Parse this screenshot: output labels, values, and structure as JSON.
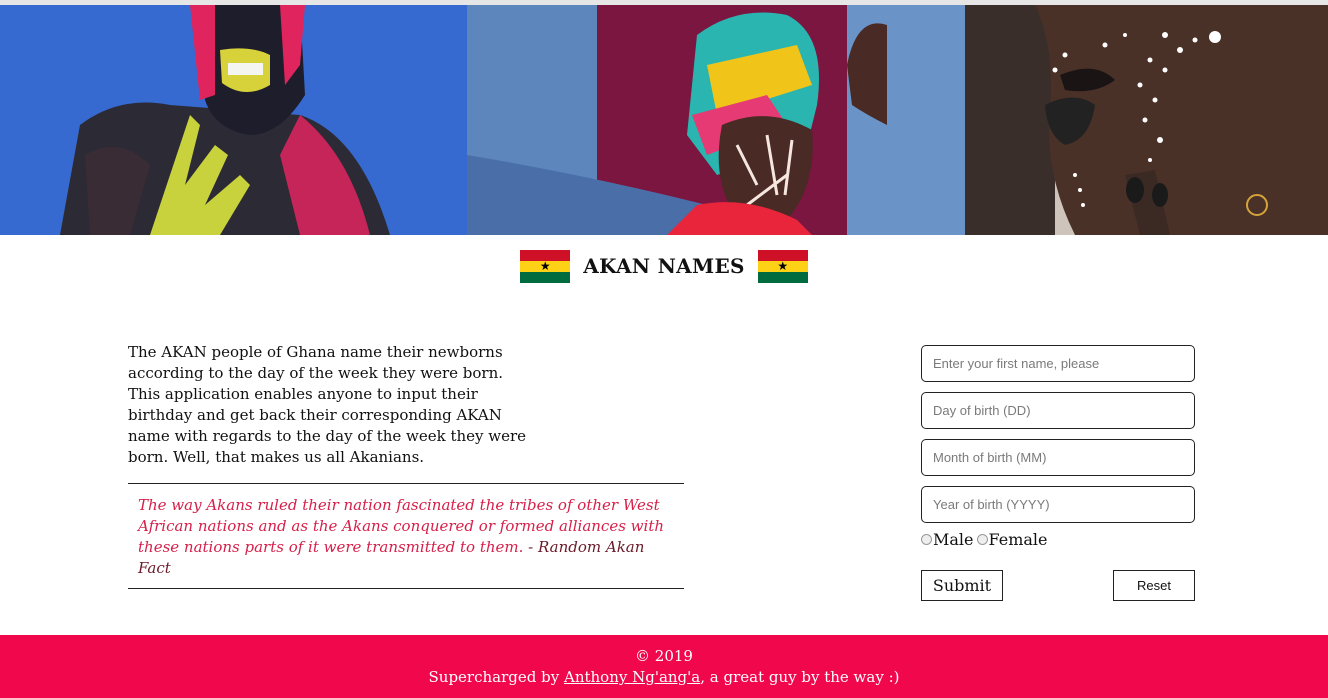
{
  "header": {
    "title": "AKAN NAMES",
    "flag_colors": [
      "#ce1126",
      "#fcd116",
      "#006b3f"
    ]
  },
  "intro": {
    "text": "The AKAN people of Ghana name their newborns according to the day of the week they were born. This application enables anyone to input their birthday and get back their corresponding AKAN name with regards to the day of the week they were born. Well, that makes us all Akanians."
  },
  "quote": {
    "text": "The way Akans ruled their nation fascinated the tribes of other West African nations and as the Akans conquered or formed alliances with these nations parts of it were transmitted to them.",
    "source": "- Random Akan Fact"
  },
  "form": {
    "first_name_placeholder": "Enter your first name, please",
    "day_placeholder": "Day of birth (DD)",
    "month_placeholder": "Month of birth (MM)",
    "year_placeholder": "Year of birth (YYYY)",
    "gender_male": "Male",
    "gender_female": "Female",
    "submit_label": "Submit",
    "reset_label": "Reset"
  },
  "footer": {
    "copyright": "© 2019",
    "credit_prefix": "Supercharged by ",
    "author": "Anthony Ng'ang'a",
    "credit_suffix": ", a great guy by the way :)",
    "background": "#f0074c"
  }
}
